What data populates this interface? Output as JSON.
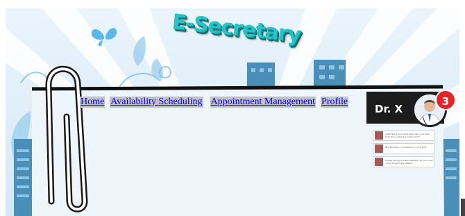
{
  "app": {
    "logo_text": "E-Secretary"
  },
  "nav": {
    "items": [
      {
        "label": "Home"
      },
      {
        "label": "Availability Scheduling"
      },
      {
        "label": "Appointment Management"
      },
      {
        "label": "Profile"
      }
    ]
  },
  "user": {
    "name": "Dr. X",
    "notification_count": "3"
  },
  "notifications": [
    {
      "text": "Justin Barry and Sarah Rena like your post: \"And then yesterday he/to mind\""
    },
    {
      "text": "Ben Bergmen commented on your post"
    },
    {
      "text": "Sophia Chung and Rein Wander like your post: \"Ahoy thing in the sheets.\""
    }
  ],
  "colors": {
    "logo": "#27c3c6",
    "link": "#0000ee",
    "link_bg": "#c0c0c8",
    "panel": "#1c1c1c",
    "badge": "#e4262a",
    "sky": "#dcecf8",
    "building": "#4a8fb8"
  },
  "icons": [
    "butterfly-icon",
    "paperclip-icon",
    "avatar-icon",
    "notification-badge-icon"
  ]
}
